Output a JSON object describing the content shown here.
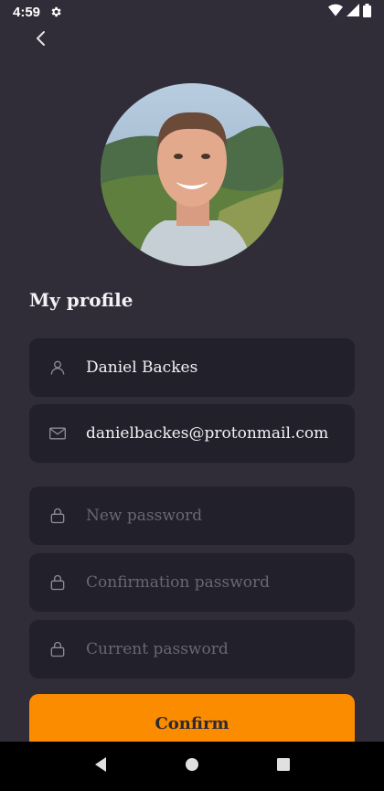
{
  "status_bar": {
    "time": "4:59",
    "icons": [
      "gear-icon",
      "wifi-icon",
      "signal-icon",
      "battery-icon"
    ]
  },
  "header": {
    "back_icon": "chevron-left-icon"
  },
  "profile": {
    "title": "My profile",
    "avatar_icon": "avatar"
  },
  "fields": {
    "name": {
      "icon": "user-icon",
      "value": "Daniel Backes"
    },
    "email": {
      "icon": "mail-icon",
      "value": "danielbackes@protonmail.com"
    },
    "new_password": {
      "icon": "lock-icon",
      "placeholder": "New password"
    },
    "confirmation_password": {
      "icon": "lock-icon",
      "placeholder": "Confirmation password"
    },
    "current_password": {
      "icon": "lock-icon",
      "placeholder": "Current password"
    }
  },
  "actions": {
    "confirm_label": "Confirm"
  },
  "colors": {
    "background": "#312d38",
    "field_background": "#22202a",
    "accent": "#fb8c00",
    "placeholder": "#6a6672"
  }
}
